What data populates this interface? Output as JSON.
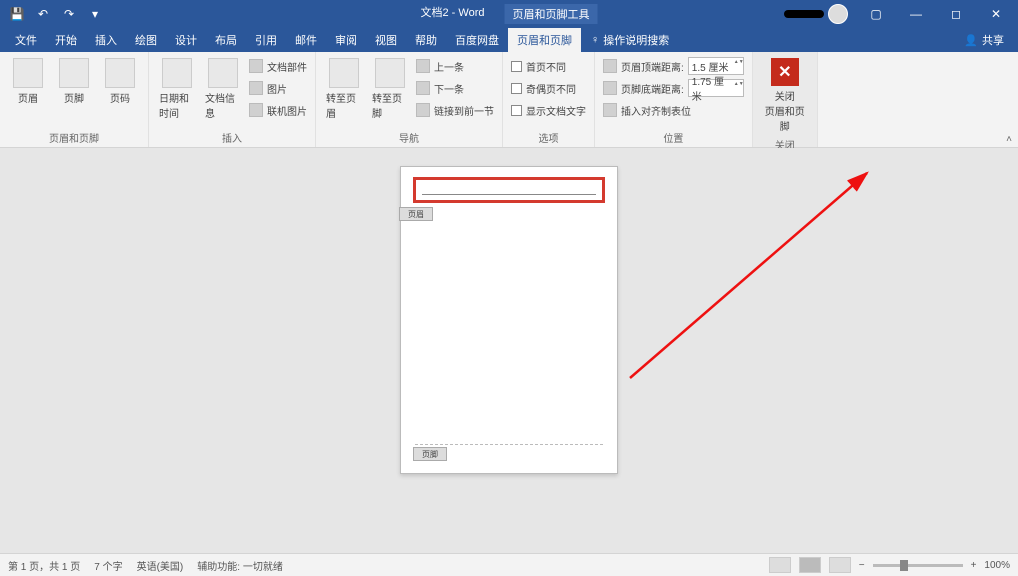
{
  "titlebar": {
    "doc_title": "文档2 - Word",
    "tool_title": "页眉和页脚工具"
  },
  "menus": {
    "items": [
      "文件",
      "开始",
      "插入",
      "绘图",
      "设计",
      "布局",
      "引用",
      "邮件",
      "审阅",
      "视图",
      "帮助",
      "百度网盘",
      "页眉和页脚"
    ],
    "tell_me": "操作说明搜索",
    "share": "共享"
  },
  "ribbon": {
    "group1": {
      "label": "页眉和页脚",
      "btn1": "页眉",
      "btn2": "页脚",
      "btn3": "页码"
    },
    "group2": {
      "label": "插入",
      "btn1": "日期和时间",
      "btn2": "文档信息",
      "r1": "文档部件",
      "r2": "图片",
      "r3": "联机图片"
    },
    "group3": {
      "label": "导航",
      "btn1": "转至页眉",
      "btn2": "转至页脚",
      "r1": "上一条",
      "r2": "下一条",
      "r3": "链接到前一节"
    },
    "group4": {
      "label": "选项",
      "r1": "首页不同",
      "r2": "奇偶页不同",
      "r3": "显示文档文字"
    },
    "group5": {
      "label": "位置",
      "r1": "页眉顶端距离:",
      "v1": "1.5 厘米",
      "r2": "页脚底端距离:",
      "v2": "1.75 厘米",
      "r3": "插入对齐制表位"
    },
    "group6": {
      "label": "关闭",
      "btn": "关闭\n页眉和页脚"
    }
  },
  "page": {
    "header_tag": "页眉",
    "footer_tag": "页脚"
  },
  "status": {
    "page": "第 1 页，共 1 页",
    "words": "7 个字",
    "lang": "英语(美国)",
    "access": "辅助功能: 一切就绪",
    "zoom": "100%"
  }
}
